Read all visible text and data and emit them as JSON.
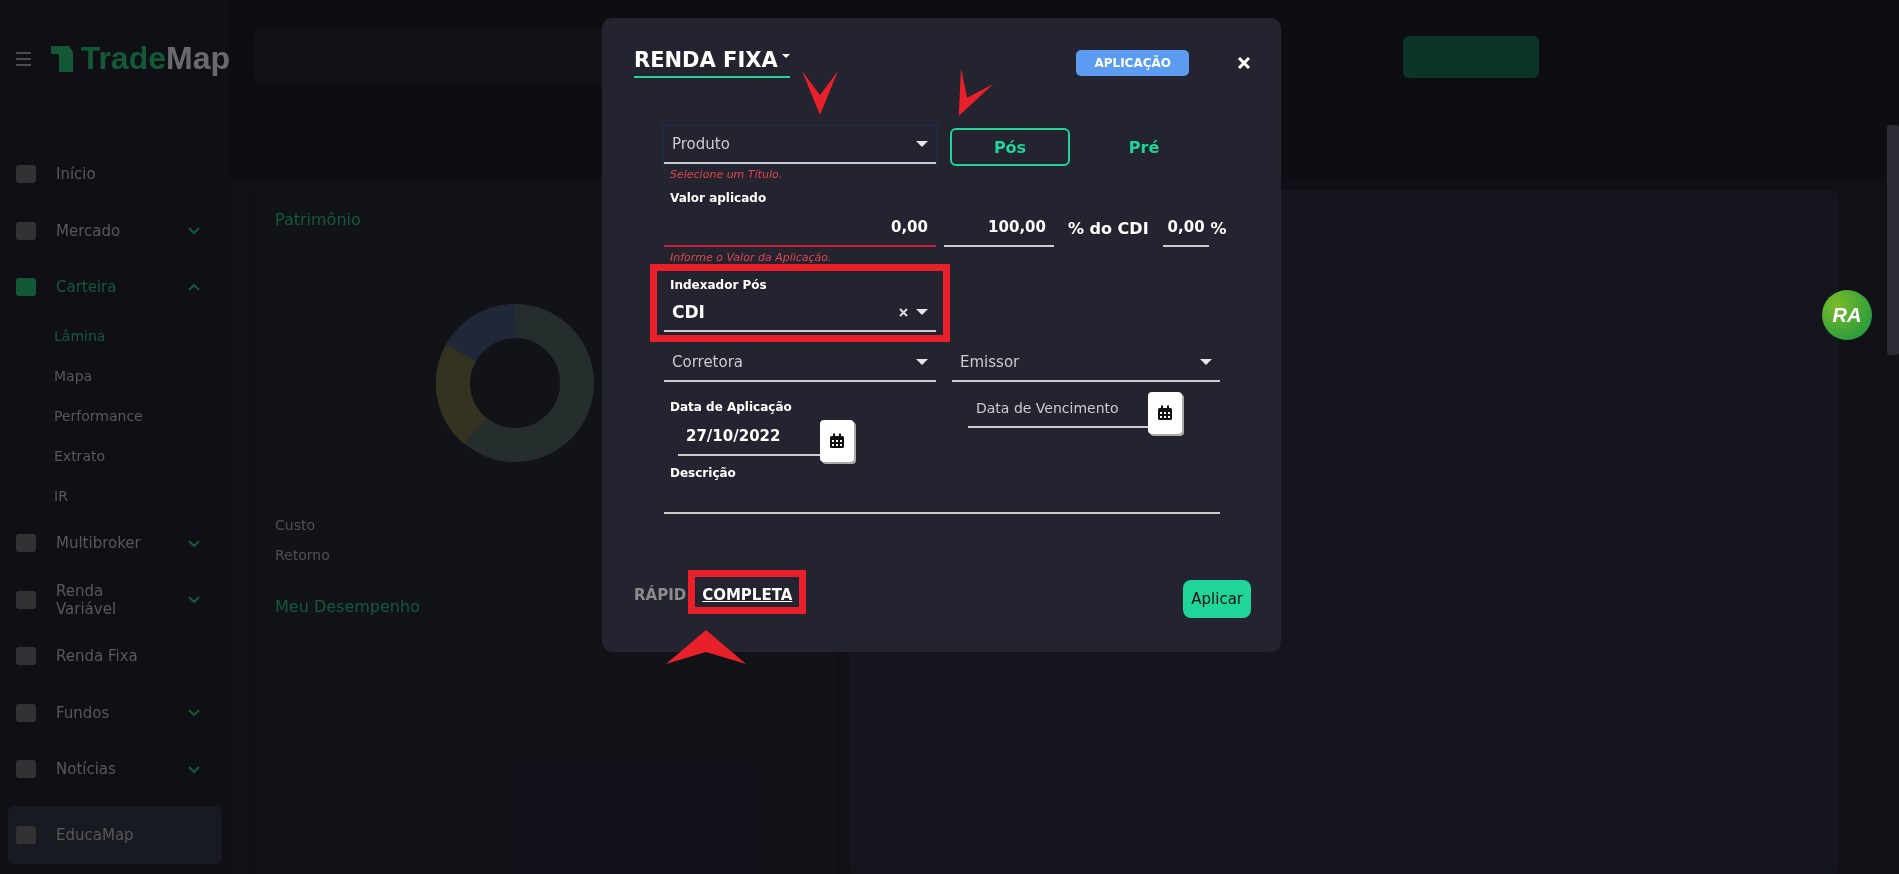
{
  "app": {
    "logo_part1": "Trade",
    "logo_part2": "Map"
  },
  "sidebar": {
    "items": [
      {
        "label": "Início",
        "selected": false,
        "expandable": false,
        "hovered": false
      },
      {
        "label": "Mercado",
        "selected": false,
        "expandable": true,
        "hovered": false
      },
      {
        "label": "Carteira",
        "selected": true,
        "expandable": true,
        "hovered": false,
        "children": [
          {
            "label": "Lâmina",
            "selected": true
          },
          {
            "label": "Mapa",
            "selected": false
          },
          {
            "label": "Performance",
            "selected": false
          },
          {
            "label": "Extrato",
            "selected": false
          },
          {
            "label": "IR",
            "selected": false
          }
        ]
      },
      {
        "label": "Multibroker",
        "selected": false,
        "expandable": true,
        "hovered": false
      },
      {
        "label": "Renda Variável",
        "selected": false,
        "expandable": true,
        "hovered": false
      },
      {
        "label": "Renda Fixa",
        "selected": false,
        "expandable": false,
        "hovered": false
      },
      {
        "label": "Fundos",
        "selected": false,
        "expandable": true,
        "hovered": false
      },
      {
        "label": "Notícias",
        "selected": false,
        "expandable": true,
        "hovered": false
      },
      {
        "label": "EducaMap",
        "selected": false,
        "expandable": false,
        "hovered": true
      }
    ]
  },
  "portfolio_card": {
    "title": "Patrimônio",
    "rows": [
      {
        "label": "Custo"
      },
      {
        "label": "Retorno"
      }
    ],
    "section": "Meu Desempenho"
  },
  "modal": {
    "title": "RENDA FIXA",
    "badge": "APLICAÇÃO",
    "product_field": {
      "placeholder": "Produto",
      "error": "Selecione um Título.",
      "arrow_marked": true
    },
    "rate_types": [
      {
        "label": "Pós",
        "selected": true,
        "arrow_marked": true
      },
      {
        "label": "Pré",
        "selected": false,
        "arrow_marked": false
      }
    ],
    "amount": {
      "label": "Valor aplicado",
      "value": "0,00",
      "error": "Informe o Valor da Aplicação."
    },
    "percent": {
      "value": "100,00",
      "suffix": "% do CDI"
    },
    "extra_rate": {
      "value": "0,00",
      "suffix": "%"
    },
    "indexer": {
      "label": "Indexador Pós",
      "value": "CDI",
      "framed": true
    },
    "broker": {
      "placeholder": "Corretora"
    },
    "issuer": {
      "placeholder": "Emissor"
    },
    "application_date": {
      "label": "Data de Aplicação",
      "value": "27/10/2022"
    },
    "maturity_date": {
      "placeholder": "Data de Vencimento"
    },
    "description": {
      "label": "Descrição"
    },
    "modes": [
      {
        "label": "RÁPID",
        "selected": false,
        "framed": false,
        "arrow_marked": false
      },
      {
        "label": "COMPLETA",
        "selected": true,
        "framed": true,
        "arrow_marked": true
      }
    ],
    "submit": "Aplicar"
  },
  "chat_badge": "RA"
}
